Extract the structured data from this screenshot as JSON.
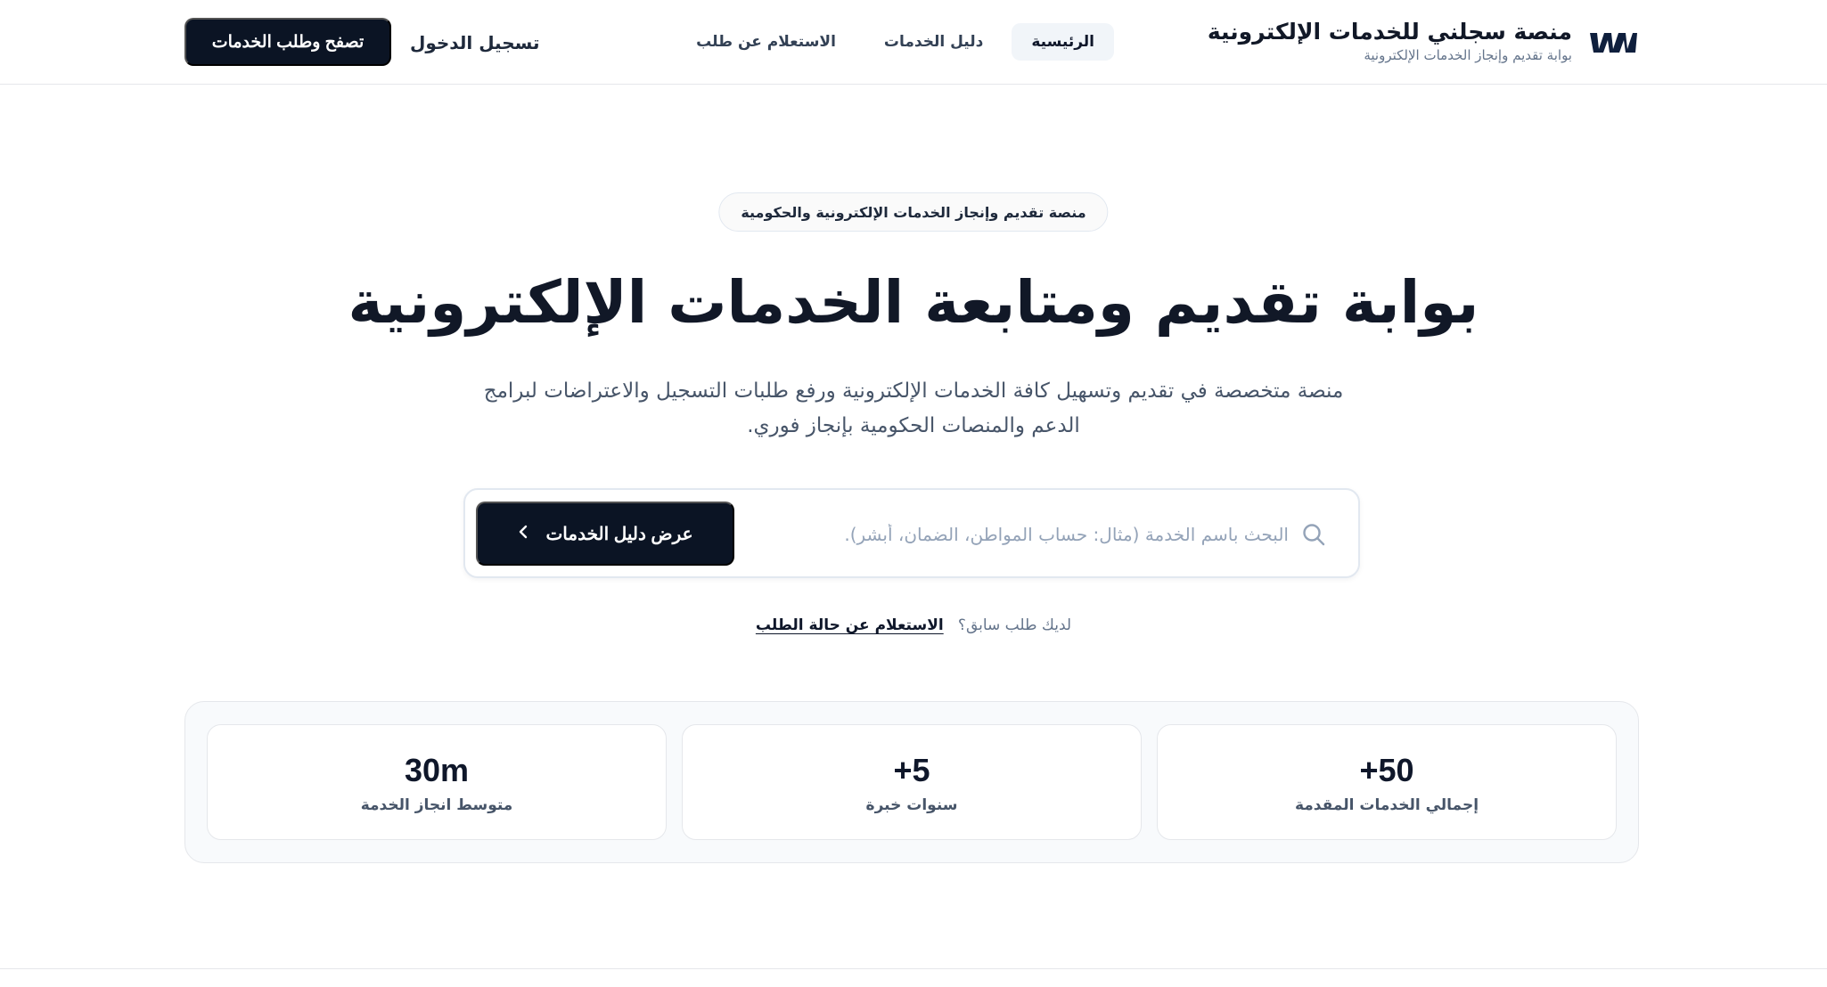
{
  "brand": {
    "title": "منصة سجلني للخدمات الإلكترونية",
    "subtitle": "بوابة تقديم وإنجاز الخدمات الإلكترونية",
    "logo_icon": "brand-wave-logo"
  },
  "nav": {
    "items": [
      {
        "label": "الرئيسية",
        "active": true
      },
      {
        "label": "دليل الخدمات",
        "active": false
      },
      {
        "label": "الاستعلام عن طلب",
        "active": false
      }
    ]
  },
  "header_actions": {
    "login_label": "تسجيل الدخول",
    "cta_label": "تصفح وطلب الخدمات"
  },
  "hero": {
    "badge": "منصة تقديم وإنجاز الخدمات الإلكترونية والحكومية",
    "title": "بوابة تقديم ومتابعة الخدمات الإلكترونية",
    "description": "منصة متخصصة في تقديم وتسهيل كافة الخدمات الإلكترونية ورفع طلبات التسجيل والاعتراضات لبرامج الدعم والمنصات الحكومية بإنجاز فوري."
  },
  "search": {
    "placeholder": "البحث باسم الخدمة (مثال: حساب المواطن، الضمان، أبشر)...",
    "value": "",
    "button_label": "عرض دليل الخدمات",
    "icon": "search-icon"
  },
  "previous_request": {
    "prompt": "لديك طلب سابق؟",
    "link_label": "الاستعلام عن حالة الطلب"
  },
  "stats": [
    {
      "value": "+50",
      "label": "إجمالي الخدمات المقدمة"
    },
    {
      "value": "+5",
      "label": "سنوات خبرة"
    },
    {
      "value": "30m",
      "label": "متوسط انجاز الخدمة"
    }
  ],
  "colors": {
    "primary_dark": "#0b1424",
    "text": "#0f172a",
    "muted": "#64748b",
    "border": "#e2e8f0",
    "nav_active_bg": "#f1f5f9"
  }
}
